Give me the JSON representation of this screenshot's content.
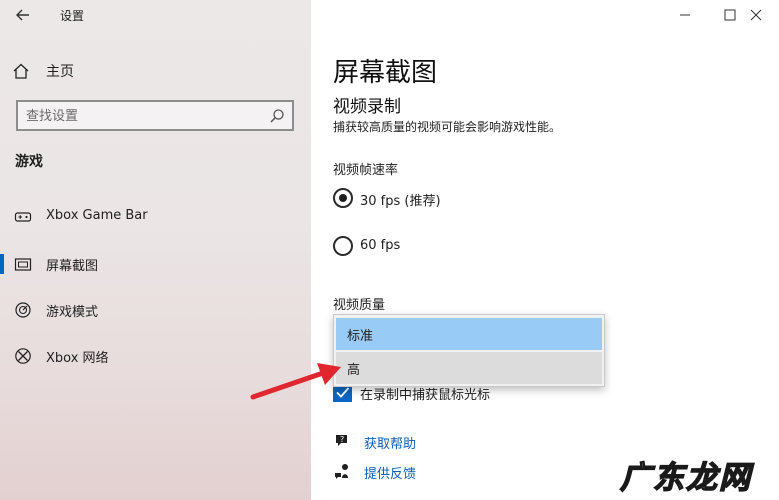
{
  "window": {
    "title": "设置",
    "controls": [
      "minimize-icon",
      "maximize-icon",
      "close-icon"
    ]
  },
  "sidebar": {
    "home_label": "主页",
    "search": {
      "placeholder": "查找设置",
      "value": ""
    },
    "section_title": "游戏",
    "items": [
      {
        "label": "Xbox Game Bar",
        "icon": "xbox-game-bar-icon",
        "selected": false
      },
      {
        "label": "屏幕截图",
        "icon": "screenshot-icon",
        "selected": true
      },
      {
        "label": "游戏模式",
        "icon": "game-mode-icon",
        "selected": false
      },
      {
        "label": "Xbox 网络",
        "icon": "xbox-icon",
        "selected": false
      }
    ]
  },
  "main": {
    "title": "屏幕截图",
    "subtitle": "视频录制",
    "description": "捕获较高质量的视频可能会影响游戏性能。",
    "framerate": {
      "label": "视频帧速率",
      "options": [
        {
          "label": "30 fps (推荐)",
          "selected": true
        },
        {
          "label": "60 fps",
          "selected": false
        }
      ]
    },
    "quality": {
      "label": "视频质量",
      "options": [
        {
          "label": "标准",
          "selected": true
        },
        {
          "label": "高",
          "selected": false
        }
      ]
    },
    "capture_cursor": {
      "label": "在录制中捕获鼠标光标",
      "checked": true
    },
    "links": [
      {
        "label": "获取帮助",
        "icon": "help-icon"
      },
      {
        "label": "提供反馈",
        "icon": "feedback-icon"
      }
    ]
  },
  "colors": {
    "accent": "#0067c0",
    "link": "#0a5fb8",
    "annotation_arrow": "#e0262e"
  },
  "watermark": {
    "text": "广东龙网"
  }
}
